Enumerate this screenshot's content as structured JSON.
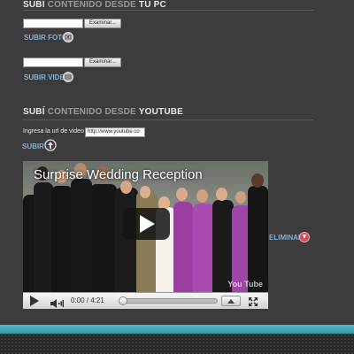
{
  "pc_section": {
    "heading_prefix": "SUBÍ",
    "heading_dim": "CONTENIDO DESDE",
    "heading_strong": "TU PC",
    "photo": {
      "browse_label": "Examinar...",
      "value": "",
      "action_label": "SUBIR FOTO"
    },
    "video": {
      "browse_label": "Examinar...",
      "value": "",
      "action_label": "SUBIR VIDEO"
    }
  },
  "youtube_section": {
    "heading_prefix": "SUBÍ",
    "heading_dim": "CONTENIDO DESDE",
    "heading_strong": "YOUTUBE",
    "url_label": "Ingresa la url de video",
    "url_value": "http://www.youtube.co",
    "submit_label": "SUBIR"
  },
  "video_player": {
    "title": "Surprise Wedding Reception",
    "time": "0:00 / 4:21",
    "progress": 0,
    "watermark": "You Tube"
  },
  "remove_label": "ELIMINAR",
  "colors": {
    "background": "#3c3c3c",
    "link": "#7fb1d6",
    "remove_icon": "#d14b58",
    "footer_band": "#4fb7c7"
  },
  "icons": {
    "photo_upload": "upload-circle-icon",
    "video_upload": "upload-circle-icon",
    "youtube_submit": "arrow-up-circle-icon",
    "remove": "delete-circle-icon"
  }
}
